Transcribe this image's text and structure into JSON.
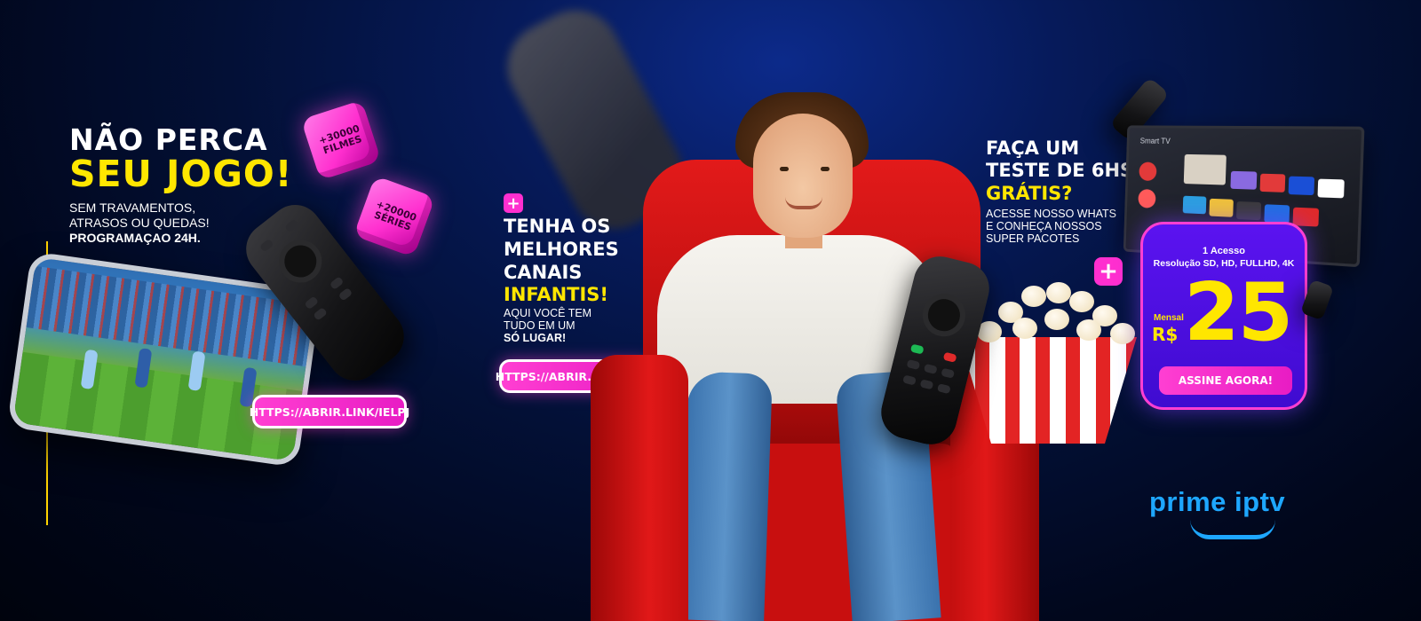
{
  "left": {
    "headline_line1": "NÃO PERCA",
    "headline_line2": "SEU JOGO!",
    "sub_line1": "SEM TRAVAMENTOS,",
    "sub_line2": "ATRASOS OU QUEDAS!",
    "sub_line3": "PROGRAMAÇAO 24H.",
    "cube_filmes_line1": "+30000",
    "cube_filmes_line2": "FILMES",
    "cube_series_line1": "+20000",
    "cube_series_line2": "SÉRIES",
    "link": "HTTPS://ABRIR.LINK/IELPJ"
  },
  "middle": {
    "plus": "+",
    "title_line1": "TENHA OS",
    "title_line2": "MELHORES",
    "title_line3": "CANAIS",
    "title_line4": "INFANTIS!",
    "sub_line1": "AQUI VOCÊ TEM",
    "sub_line2": "TUDO EM UM",
    "sub_line3": "SÓ LUGAR!",
    "link": "HTTPS://ABRIR.LINK/IELPJ"
  },
  "right": {
    "title_line1": "FAÇA UM",
    "title_line2": "TESTE DE 6HS",
    "title_line3": "GRÁTIS?",
    "sub_line1": "ACESSE NOSSO WHATS",
    "sub_line2": "E CONHEÇA NOSSOS",
    "sub_line3": "SUPER PACOTES",
    "plus": "+",
    "tv_label": "Smart TV"
  },
  "price_card": {
    "line1": "1 Acesso",
    "line2": "Resolução SD, HD, FULLHD, 4K",
    "mensal": "Mensal",
    "currency": "R$",
    "price": "25",
    "cta": "ASSINE AGORA!"
  },
  "logo": {
    "text": "prime iptv"
  },
  "colors": {
    "accent_pink": "#ff2fcf",
    "accent_yellow": "#ffe600",
    "accent_blue": "#1ea7ff",
    "card_purple": "#4f10e6"
  }
}
